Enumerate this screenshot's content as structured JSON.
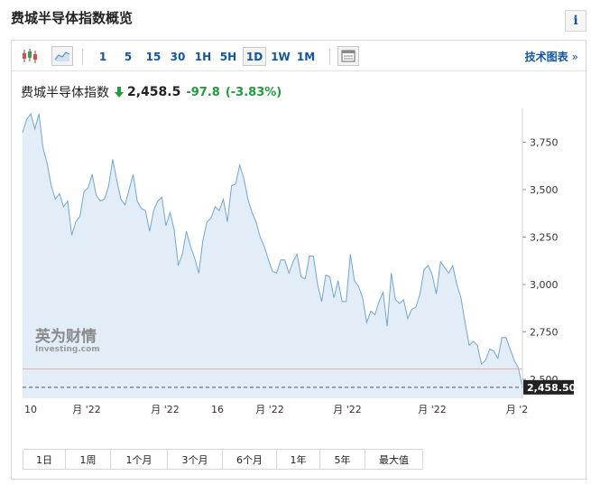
{
  "header": {
    "title": "费城半导体指数概览",
    "info_label": "i"
  },
  "toolbar": {
    "chart_type_icons": [
      "candlestick-icon",
      "area-chart-icon"
    ],
    "timeframes": [
      "1",
      "5",
      "15",
      "30",
      "1H",
      "5H",
      "1D",
      "1W",
      "1M"
    ],
    "active_timeframe": "1D",
    "table_icon": "table-icon",
    "tech_chart_label": "技术图表",
    "tech_chart_arrow": "»"
  },
  "quote": {
    "name": "费城半导体指数",
    "price": "2,458.5",
    "change": "-97.8",
    "change_pct": "(-3.83%)",
    "direction": "down",
    "change_color": "#1e9e3b"
  },
  "chart_data": {
    "type": "area",
    "y_ticks": [
      "3,750",
      "3,500",
      "3,250",
      "3,000",
      "2,750",
      "2,500"
    ],
    "y_tick_values": [
      3750,
      3500,
      3250,
      3000,
      2750,
      2500
    ],
    "ylim": [
      2400,
      3900
    ],
    "x_tick_labels": [
      "10",
      "月 '22",
      "月 '22",
      "16",
      "月 '22",
      "月 '22",
      "月 '22",
      "月 '2"
    ],
    "last_price_label": "2,458.50",
    "reference_level": 2555,
    "line_color": "#6fa6d3",
    "fill_color": "#e3edf7",
    "values": [
      3800,
      3870,
      3900,
      3820,
      3900,
      3720,
      3640,
      3520,
      3450,
      3480,
      3410,
      3440,
      3260,
      3330,
      3360,
      3490,
      3510,
      3580,
      3470,
      3440,
      3450,
      3520,
      3660,
      3550,
      3450,
      3420,
      3500,
      3580,
      3440,
      3400,
      3390,
      3280,
      3390,
      3440,
      3460,
      3310,
      3380,
      3290,
      3100,
      3160,
      3280,
      3200,
      3140,
      3060,
      3230,
      3330,
      3350,
      3410,
      3390,
      3450,
      3330,
      3520,
      3530,
      3630,
      3560,
      3450,
      3380,
      3330,
      3250,
      3200,
      3130,
      3070,
      3060,
      3130,
      3130,
      3060,
      3120,
      3160,
      3040,
      3030,
      3150,
      3150,
      3000,
      2910,
      3050,
      3040,
      2930,
      3020,
      2910,
      2910,
      3160,
      3020,
      2990,
      2930,
      2800,
      2860,
      2840,
      2910,
      2960,
      2780,
      3060,
      2920,
      2900,
      2920,
      2820,
      2870,
      2880,
      2950,
      3080,
      3100,
      3050,
      2950,
      3120,
      3090,
      3060,
      3100,
      3000,
      2930,
      2800,
      2680,
      2700,
      2680,
      2580,
      2600,
      2660,
      2650,
      2610,
      2720,
      2720,
      2660,
      2600,
      2560,
      2458
    ]
  },
  "watermark": {
    "cn": "英为财情",
    "en": "Investing.com"
  },
  "ranges": [
    "1日",
    "1周",
    "1个月",
    "3个月",
    "6个月",
    "1年",
    "5年",
    "最大值"
  ]
}
